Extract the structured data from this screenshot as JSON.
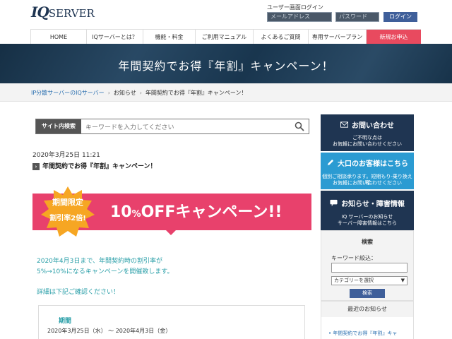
{
  "header": {
    "logo_iq": "IQ",
    "logo_server": "SERVER",
    "login_title": "ユーザー画面ログイン",
    "email_placeholder": "メールアドレス",
    "password_placeholder": "パスワード",
    "login_label": "ログイン"
  },
  "nav": {
    "items": [
      {
        "label": "HOME"
      },
      {
        "label": "IQサーバーとは？"
      },
      {
        "label": "機能・料金"
      },
      {
        "label": "ご利用マニュアル"
      },
      {
        "label": "よくあるご質問"
      },
      {
        "label": "専用サーバープラン"
      },
      {
        "label": "新規お申込"
      }
    ]
  },
  "banner": {
    "title": "年間契約でお得『年割』キャンペーン！"
  },
  "breadcrumb": {
    "items": [
      "IP分散サーバーのIQサーバー",
      "お知らせ",
      "年間契約でお得『年割』キャンペーン！"
    ]
  },
  "search": {
    "label": "サイト内検索",
    "placeholder": "キーワードを入力してください"
  },
  "post": {
    "date": "2020年3月25日 11:21",
    "title": "年間契約でお得『年割』キャンペーン！"
  },
  "campaign": {
    "burst_line1": "期間限定",
    "burst_line2": "割引率2倍!",
    "headline_num": "10",
    "headline_pct": "%",
    "headline_rest": "OFFキャンペーン!!"
  },
  "body": {
    "line1": "2020年4月3日まで、年間契約時の割引率が",
    "line2": "5%→10%になるキャンペーンを開催致します。",
    "line3": "詳細は下記ご確認ください！",
    "period_label": "期間",
    "period_value": "2020年3月25日（水） 〜 2020年4月3日（金）"
  },
  "sidebar": {
    "contact_title": "お問い合わせ",
    "contact_sub1": "ご不明な点は",
    "contact_sub2": "お気軽にお問い合わせください",
    "large_title": "大口のお客様はこちら",
    "large_sub1": "個別ご相談承ります。短期もり-乗り換え等",
    "large_sub2": "お気軽にお問い合わせください",
    "info_title": "お知らせ・障害情報",
    "info_sub1": "IQ サーバーのお知らせ",
    "info_sub2": "サーバー障害情報はこちら",
    "search_head": "検索",
    "keyword_label": "キーワード絞込：",
    "category_value": "カテゴリーを選択",
    "search_button": "検索",
    "recent_head": "最近のお知らせ",
    "recent_item": "年間契約でお得『年割』キャ"
  },
  "colors": {
    "navy": "#1f3552",
    "accent_pink": "#e8416c",
    "burst_orange": "#f6a623",
    "teal_text": "#2a9fa8",
    "sky_blue": "#2b9bd2",
    "apply_red": "#e84a5f"
  }
}
